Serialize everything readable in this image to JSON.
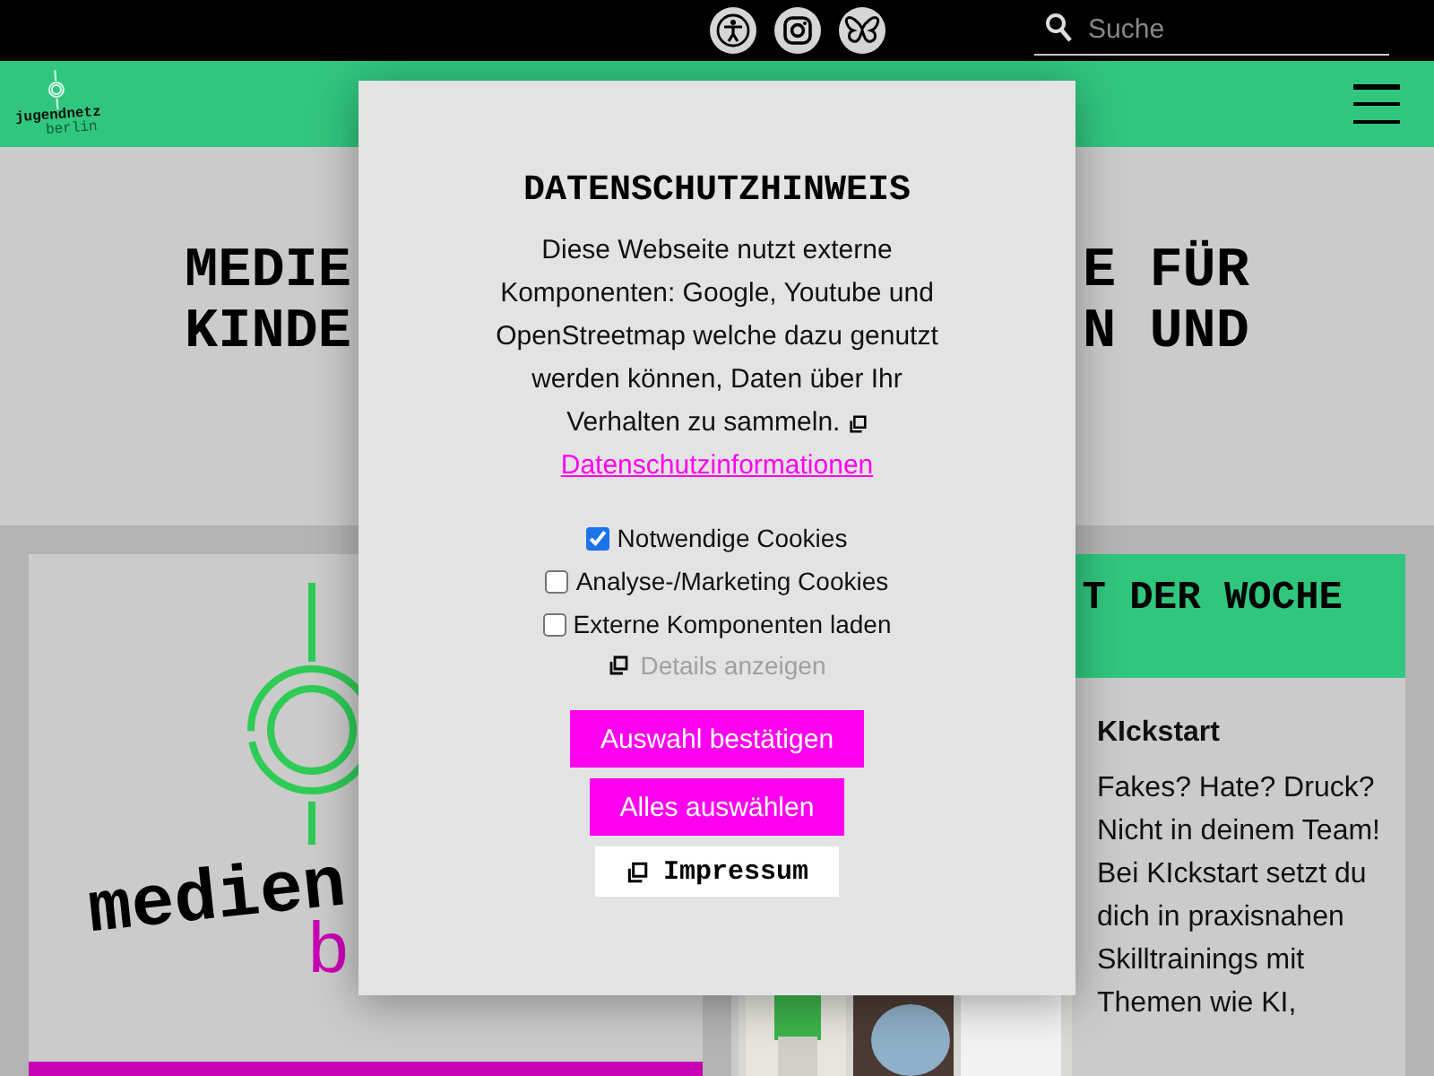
{
  "top_bar": {
    "search": {
      "placeholder": "Suche"
    }
  },
  "nav": {
    "logo": [
      "jugendnetz",
      "berlin"
    ]
  },
  "hero": {
    "lines": [
      {
        "left": "MEDIE",
        "right": "E FÜR"
      },
      {
        "left": "KINDE",
        "right": "N UND"
      }
    ]
  },
  "feature_card": {
    "logo_text": [
      "medien",
      "b"
    ]
  },
  "week_card": {
    "title": "T DER WOCHE",
    "item_title": "KIckstart",
    "item_text": "Fakes? Hate? Druck? Nicht in deinem Team! Bei KIckstart setzt du dich in praxisnahen Skilltrainings mit Themen wie KI,"
  },
  "dialog": {
    "title": "DATENSCHUTZHINWEIS",
    "text": "Diese Webseite nutzt externe Komponenten: Google, Youtube und OpenStreetmap welche dazu genutzt werden können, Daten über Ihr Verhalten zu sammeln.",
    "link": "Datenschutzinformationen",
    "options": [
      {
        "label": "Notwendige Cookies",
        "checked": true
      },
      {
        "label": "Analyse-/Marketing Cookies",
        "checked": false
      },
      {
        "label": "Externe Komponenten laden",
        "checked": false
      }
    ],
    "details": "Details anzeigen",
    "buttons": [
      {
        "label": "Auswahl bestätigen",
        "kind": "primary"
      },
      {
        "label": "Alles auswählen",
        "kind": "primary"
      },
      {
        "label": "Impressum",
        "kind": "secondary"
      }
    ]
  }
}
